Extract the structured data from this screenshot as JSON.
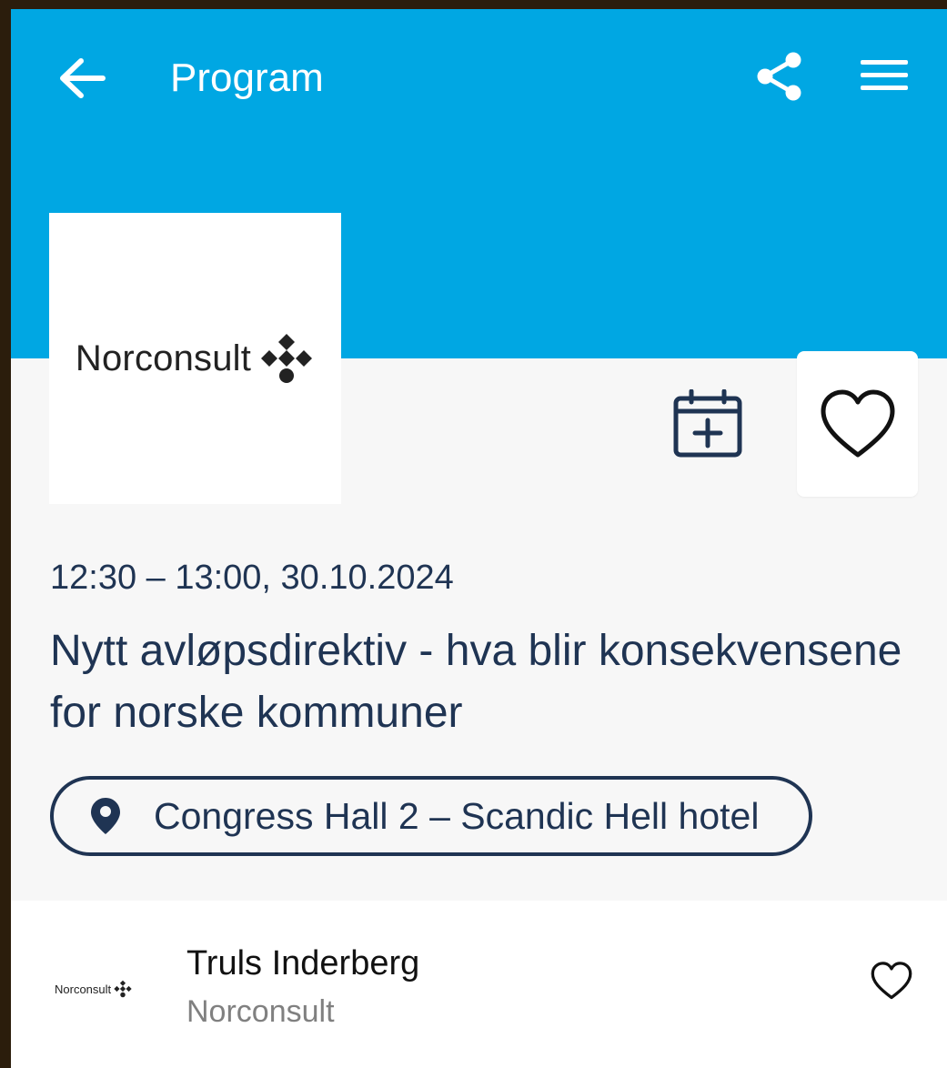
{
  "header": {
    "title": "Program",
    "back_icon": "arrow-left-icon",
    "share_icon": "share-icon",
    "menu_icon": "hamburger-menu-icon",
    "background_color": "#00a7e3"
  },
  "session": {
    "organizer_logo_text": "Norconsult",
    "time": "12:30 – 13:00, 30.10.2024",
    "title": "Nytt avløpsdirektiv - hva blir konsekvensene for norske kommuner",
    "location": "Congress Hall 2 – Scandic Hell hotel",
    "text_color": "#1f3453"
  },
  "speaker": {
    "logo_text": "Norconsult",
    "name": "Truls Inderberg",
    "organization": "Norconsult"
  }
}
